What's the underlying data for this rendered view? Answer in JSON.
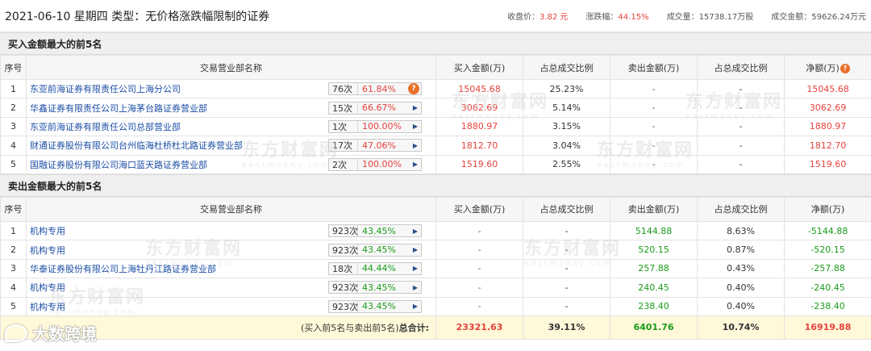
{
  "header": {
    "title": "2021-06-10 星期四 类型：无价格涨跌幅限制的证券",
    "close_label": "收盘价：",
    "close_value": "3.82 元",
    "change_label": "涨跌幅：",
    "change_value": "44.15%",
    "volume_label": "成交量：",
    "volume_value": "15738.17万股",
    "amount_label": "成交金额：",
    "amount_value": "59626.24万元"
  },
  "buy_section": {
    "title": "买入金额最大的前5名",
    "columns": [
      "序号",
      "交易营业部名称",
      "买入金额(万)",
      "占总成交比例",
      "卖出金额(万)",
      "占总成交比例",
      "净额(万)"
    ],
    "rows": [
      {
        "idx": "1",
        "name": "东亚前海证券有限责任公司上海分公司",
        "count": "76次",
        "pct": "61.84%",
        "buy": "15045.68",
        "buy_ratio": "25.23%",
        "sell": "-",
        "sell_ratio": "-",
        "net": "15045.68"
      },
      {
        "idx": "2",
        "name": "华鑫证券有限责任公司上海茅台路证券营业部",
        "count": "15次",
        "pct": "66.67%",
        "buy": "3062.69",
        "buy_ratio": "5.14%",
        "sell": "-",
        "sell_ratio": "-",
        "net": "3062.69"
      },
      {
        "idx": "3",
        "name": "东亚前海证券有限责任公司总部营业部",
        "count": "1次",
        "pct": "100.00%",
        "buy": "1880.97",
        "buy_ratio": "3.15%",
        "sell": "-",
        "sell_ratio": "-",
        "net": "1880.97"
      },
      {
        "idx": "4",
        "name": "财通证券股份有限公司台州临海杜桥杜北路证券营业部",
        "count": "17次",
        "pct": "47.06%",
        "buy": "1812.70",
        "buy_ratio": "3.04%",
        "sell": "-",
        "sell_ratio": "-",
        "net": "1812.70"
      },
      {
        "idx": "5",
        "name": "国融证券股份有限公司海口蓝天路证券营业部",
        "count": "2次",
        "pct": "100.00%",
        "buy": "1519.60",
        "buy_ratio": "2.55%",
        "sell": "-",
        "sell_ratio": "-",
        "net": "1519.60"
      }
    ]
  },
  "sell_section": {
    "title": "卖出金额最大的前5名",
    "columns": [
      "序号",
      "交易营业部名称",
      "买入金额(万)",
      "占总成交比例",
      "卖出金额(万)",
      "占总成交比例",
      "净额(万)"
    ],
    "rows": [
      {
        "idx": "1",
        "name": "机构专用",
        "count": "923次",
        "pct": "43.45%",
        "buy": "-",
        "buy_ratio": "-",
        "sell": "5144.88",
        "sell_ratio": "8.63%",
        "net": "-5144.88"
      },
      {
        "idx": "2",
        "name": "机构专用",
        "count": "923次",
        "pct": "43.45%",
        "buy": "-",
        "buy_ratio": "-",
        "sell": "520.15",
        "sell_ratio": "0.87%",
        "net": "-520.15"
      },
      {
        "idx": "3",
        "name": "华泰证券股份有限公司上海牡丹江路证券营业部",
        "count": "18次",
        "pct": "44.44%",
        "buy": "-",
        "buy_ratio": "-",
        "sell": "257.88",
        "sell_ratio": "0.43%",
        "net": "-257.88"
      },
      {
        "idx": "4",
        "name": "机构专用",
        "count": "923次",
        "pct": "43.45%",
        "buy": "-",
        "buy_ratio": "-",
        "sell": "240.45",
        "sell_ratio": "0.40%",
        "net": "-240.45"
      },
      {
        "idx": "5",
        "name": "机构专用",
        "count": "923次",
        "pct": "43.45%",
        "buy": "-",
        "buy_ratio": "-",
        "sell": "238.40",
        "sell_ratio": "0.40%",
        "net": "-238.40"
      }
    ]
  },
  "total": {
    "label_prefix": "(买入前5名与卖出前5名)",
    "label_bold": "总合计:",
    "buy": "23321.63",
    "buy_ratio": "39.11%",
    "sell": "6401.76",
    "sell_ratio": "10.74%",
    "net": "16919.88"
  },
  "watermark": {
    "brand": "东方财富网",
    "domain": "eastmoney.com"
  },
  "corner_brand": "大数跨境",
  "colors": {
    "up": "#e5423d",
    "down": "#1a9c1a",
    "link": "#1c4ea5",
    "help_badge": "#e8702a",
    "total_bg": "#fff8d9"
  },
  "icons": {
    "expand": "right-triangle-icon",
    "help": "question-icon"
  }
}
